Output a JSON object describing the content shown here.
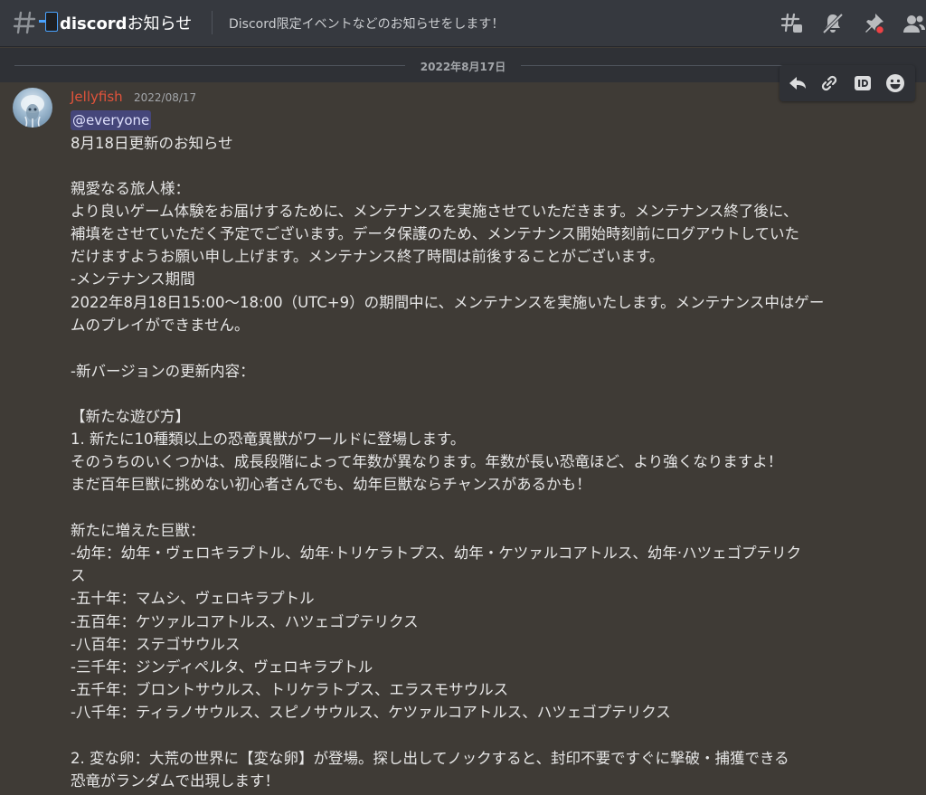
{
  "header": {
    "channel_name_bold": "discord",
    "channel_name_rest": "お知らせ",
    "topic": "Discord限定イベントなどのお知らせをします！",
    "icons": [
      "threads-icon",
      "mute-bell-icon",
      "pin-icon",
      "members-icon"
    ],
    "icon_color": "#b9bbbe",
    "pin_dot_color": "#ed4245"
  },
  "date_divider": {
    "text": "2022年8月17日"
  },
  "message_toolbar": {
    "icons": [
      "reply-icon",
      "copy-link-icon",
      "copy-id-icon",
      "add-reaction-icon"
    ]
  },
  "message": {
    "author": "Jellyfish",
    "author_color": "#e0533b",
    "timestamp": "2022/08/17",
    "mention": "@everyone",
    "lines": [
      "8月18日更新のお知らせ",
      "",
      "親愛なる旅人様：",
      "より良いゲーム体験をお届けするために、メンテナンスを実施させていただきます。メンテナンス終了後に、",
      "補填をさせていただく予定でございます。データ保護のため、メンテナンス開始時刻前にログアウトしていた",
      "だけますようお願い申し上げます。メンテナンス終了時間は前後することがございます。",
      "-メンテナンス期間",
      "2022年8月18日15:00〜18:00（UTC+9）の期間中に、メンテナンスを実施いたします。メンテナンス中はゲー",
      "ムのプレイができません。",
      "",
      "-新バージョンの更新内容：",
      "",
      "【新たな遊び方】",
      "1. 新たに10種類以上の恐竜異獣がワールドに登場します。",
      "そのうちのいくつかは、成長段階によって年数が異なります。年数が長い恐竜ほど、より強くなりますよ！",
      "まだ百年巨獣に挑めない初心者さんでも、幼年巨獣ならチャンスがあるかも！",
      "",
      "新たに増えた巨獣：",
      "-幼年：幼年・ヴェロキラプトル、幼年·トリケラトプス、幼年・ケツァルコアトルス、幼年·ハツェゴプテリク",
      "ス",
      "-五十年：マムシ、ヴェロキラプトル",
      "-五百年：ケツァルコアトルス、ハツェゴプテリクス",
      "-八百年：ステゴサウルス",
      "-三千年：ジンディペルタ、ヴェロキラプトル",
      "-五千年：ブロントサウルス、トリケラトプス、エラスモサウルス",
      "-八千年：ティラノサウルス、スピノサウルス、ケツァルコアトルス、ハツェゴプテリクス",
      "",
      "2. 変な卵：大荒の世界に【変な卵】が登場。探し出してノックすると、封印不要ですぐに撃破・捕獲できる",
      "恐竜がランダムで出現します！"
    ]
  }
}
